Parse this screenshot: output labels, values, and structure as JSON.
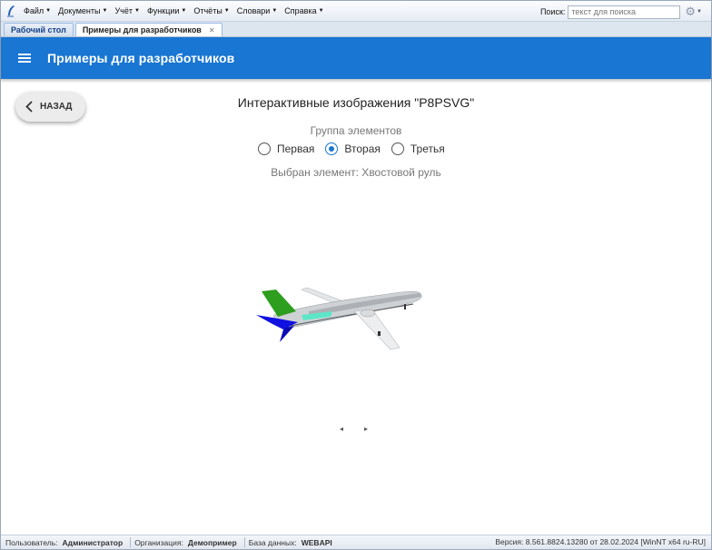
{
  "menu": {
    "items": [
      {
        "label": "Файл"
      },
      {
        "label": "Документы"
      },
      {
        "label": "Учёт"
      },
      {
        "label": "Функции"
      },
      {
        "label": "Отчёты"
      },
      {
        "label": "Словари"
      },
      {
        "label": "Справка"
      }
    ],
    "search_label": "Поиск:",
    "search_placeholder": "текст для поиска"
  },
  "tabs": [
    {
      "label": "Рабочий стол",
      "active": false
    },
    {
      "label": "Примеры для разработчиков",
      "active": true
    }
  ],
  "header": {
    "title": "Примеры для разработчиков",
    "color": "#1976d2"
  },
  "back_button": {
    "label": "НАЗАД"
  },
  "page": {
    "title": "Интерактивные изображения \"P8PSVG\"",
    "group_label": "Группа элементов",
    "radios": [
      {
        "label": "Первая",
        "checked": false
      },
      {
        "label": "Вторая",
        "checked": true
      },
      {
        "label": "Третья",
        "checked": false
      }
    ],
    "selected_text": "Выбран элемент: Хвостовой руль"
  },
  "image": {
    "highlight_colors": {
      "vertical_tail": "#2e9e1f",
      "horizontal_tail": "#1010e0",
      "fuselage_stripe": "#5de6c8"
    }
  },
  "pager": {
    "prev": "◂",
    "next": "▸"
  },
  "status": {
    "user_label": "Пользователь:",
    "user": "Администратор",
    "org_label": "Организация:",
    "org": "Демопример",
    "db_label": "База данных:",
    "db": "WEBAPI",
    "version": "Версия: 8.561.8824.13280 от 28.02.2024 [WinNT x64 ru-RU]"
  }
}
